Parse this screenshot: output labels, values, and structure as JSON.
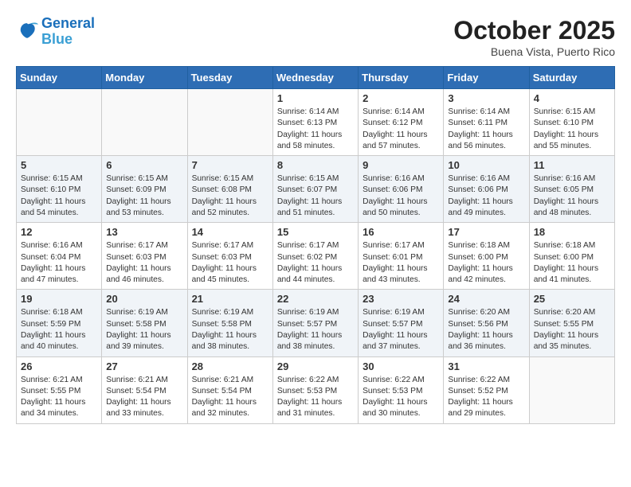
{
  "header": {
    "logo_line1": "General",
    "logo_line2": "Blue",
    "month": "October 2025",
    "location": "Buena Vista, Puerto Rico"
  },
  "weekdays": [
    "Sunday",
    "Monday",
    "Tuesday",
    "Wednesday",
    "Thursday",
    "Friday",
    "Saturday"
  ],
  "weeks": [
    [
      {
        "day": "",
        "info": ""
      },
      {
        "day": "",
        "info": ""
      },
      {
        "day": "",
        "info": ""
      },
      {
        "day": "1",
        "info": "Sunrise: 6:14 AM\nSunset: 6:13 PM\nDaylight: 11 hours\nand 58 minutes."
      },
      {
        "day": "2",
        "info": "Sunrise: 6:14 AM\nSunset: 6:12 PM\nDaylight: 11 hours\nand 57 minutes."
      },
      {
        "day": "3",
        "info": "Sunrise: 6:14 AM\nSunset: 6:11 PM\nDaylight: 11 hours\nand 56 minutes."
      },
      {
        "day": "4",
        "info": "Sunrise: 6:15 AM\nSunset: 6:10 PM\nDaylight: 11 hours\nand 55 minutes."
      }
    ],
    [
      {
        "day": "5",
        "info": "Sunrise: 6:15 AM\nSunset: 6:10 PM\nDaylight: 11 hours\nand 54 minutes."
      },
      {
        "day": "6",
        "info": "Sunrise: 6:15 AM\nSunset: 6:09 PM\nDaylight: 11 hours\nand 53 minutes."
      },
      {
        "day": "7",
        "info": "Sunrise: 6:15 AM\nSunset: 6:08 PM\nDaylight: 11 hours\nand 52 minutes."
      },
      {
        "day": "8",
        "info": "Sunrise: 6:15 AM\nSunset: 6:07 PM\nDaylight: 11 hours\nand 51 minutes."
      },
      {
        "day": "9",
        "info": "Sunrise: 6:16 AM\nSunset: 6:06 PM\nDaylight: 11 hours\nand 50 minutes."
      },
      {
        "day": "10",
        "info": "Sunrise: 6:16 AM\nSunset: 6:06 PM\nDaylight: 11 hours\nand 49 minutes."
      },
      {
        "day": "11",
        "info": "Sunrise: 6:16 AM\nSunset: 6:05 PM\nDaylight: 11 hours\nand 48 minutes."
      }
    ],
    [
      {
        "day": "12",
        "info": "Sunrise: 6:16 AM\nSunset: 6:04 PM\nDaylight: 11 hours\nand 47 minutes."
      },
      {
        "day": "13",
        "info": "Sunrise: 6:17 AM\nSunset: 6:03 PM\nDaylight: 11 hours\nand 46 minutes."
      },
      {
        "day": "14",
        "info": "Sunrise: 6:17 AM\nSunset: 6:03 PM\nDaylight: 11 hours\nand 45 minutes."
      },
      {
        "day": "15",
        "info": "Sunrise: 6:17 AM\nSunset: 6:02 PM\nDaylight: 11 hours\nand 44 minutes."
      },
      {
        "day": "16",
        "info": "Sunrise: 6:17 AM\nSunset: 6:01 PM\nDaylight: 11 hours\nand 43 minutes."
      },
      {
        "day": "17",
        "info": "Sunrise: 6:18 AM\nSunset: 6:00 PM\nDaylight: 11 hours\nand 42 minutes."
      },
      {
        "day": "18",
        "info": "Sunrise: 6:18 AM\nSunset: 6:00 PM\nDaylight: 11 hours\nand 41 minutes."
      }
    ],
    [
      {
        "day": "19",
        "info": "Sunrise: 6:18 AM\nSunset: 5:59 PM\nDaylight: 11 hours\nand 40 minutes."
      },
      {
        "day": "20",
        "info": "Sunrise: 6:19 AM\nSunset: 5:58 PM\nDaylight: 11 hours\nand 39 minutes."
      },
      {
        "day": "21",
        "info": "Sunrise: 6:19 AM\nSunset: 5:58 PM\nDaylight: 11 hours\nand 38 minutes."
      },
      {
        "day": "22",
        "info": "Sunrise: 6:19 AM\nSunset: 5:57 PM\nDaylight: 11 hours\nand 38 minutes."
      },
      {
        "day": "23",
        "info": "Sunrise: 6:19 AM\nSunset: 5:57 PM\nDaylight: 11 hours\nand 37 minutes."
      },
      {
        "day": "24",
        "info": "Sunrise: 6:20 AM\nSunset: 5:56 PM\nDaylight: 11 hours\nand 36 minutes."
      },
      {
        "day": "25",
        "info": "Sunrise: 6:20 AM\nSunset: 5:55 PM\nDaylight: 11 hours\nand 35 minutes."
      }
    ],
    [
      {
        "day": "26",
        "info": "Sunrise: 6:21 AM\nSunset: 5:55 PM\nDaylight: 11 hours\nand 34 minutes."
      },
      {
        "day": "27",
        "info": "Sunrise: 6:21 AM\nSunset: 5:54 PM\nDaylight: 11 hours\nand 33 minutes."
      },
      {
        "day": "28",
        "info": "Sunrise: 6:21 AM\nSunset: 5:54 PM\nDaylight: 11 hours\nand 32 minutes."
      },
      {
        "day": "29",
        "info": "Sunrise: 6:22 AM\nSunset: 5:53 PM\nDaylight: 11 hours\nand 31 minutes."
      },
      {
        "day": "30",
        "info": "Sunrise: 6:22 AM\nSunset: 5:53 PM\nDaylight: 11 hours\nand 30 minutes."
      },
      {
        "day": "31",
        "info": "Sunrise: 6:22 AM\nSunset: 5:52 PM\nDaylight: 11 hours\nand 29 minutes."
      },
      {
        "day": "",
        "info": ""
      }
    ]
  ]
}
